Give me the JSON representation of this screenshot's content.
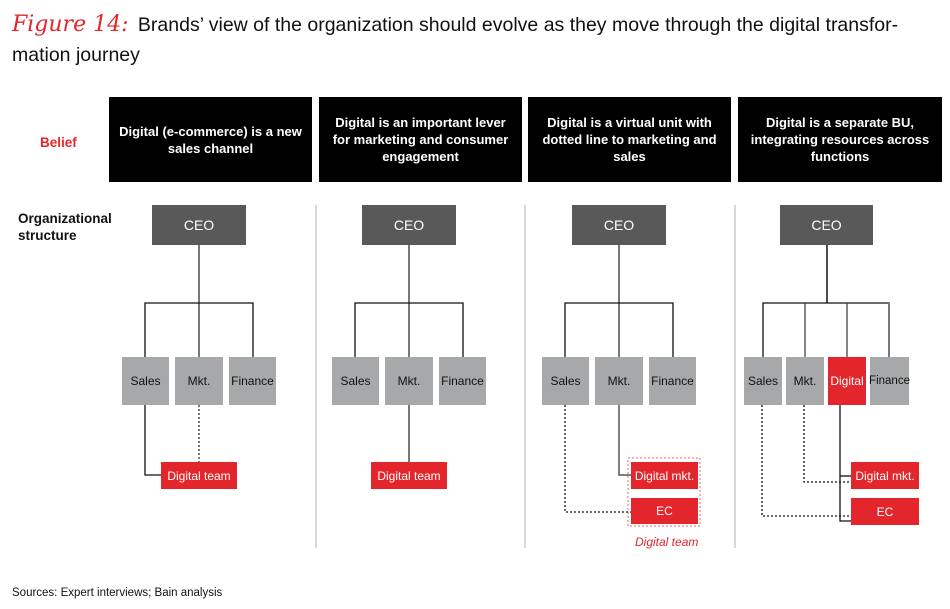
{
  "title": {
    "figure_label": "Figure 14:",
    "text": "Brands’ view of the organization should evolve as they move through the digital transfor-mation journey"
  },
  "row_labels": {
    "belief": "Belief",
    "org_structure": "Organizational structure"
  },
  "colors": {
    "accent_red": "#e3262b",
    "ceo_gray": "#595959",
    "dept_gray": "#a7a8aa",
    "belief_bg": "#000000"
  },
  "stages": [
    {
      "belief": "Digital (e-commerce) is a new sales channel",
      "ceo": "CEO",
      "departments": [
        "Sales",
        "Mkt.",
        "Finance"
      ],
      "digital_units": [
        "Digital team"
      ],
      "links": [
        {
          "from": "Sales",
          "to": "Digital team",
          "style": "solid"
        },
        {
          "from": "Mkt.",
          "to": "Digital team",
          "style": "dotted"
        }
      ]
    },
    {
      "belief": "Digital is an important lever for marketing and consumer engagement",
      "ceo": "CEO",
      "departments": [
        "Sales",
        "Mkt.",
        "Finance"
      ],
      "digital_units": [
        "Digital team"
      ],
      "links": [
        {
          "from": "Mkt.",
          "to": "Digital team",
          "style": "solid"
        }
      ]
    },
    {
      "belief": "Digital is a virtual unit with dotted line to marketing and sales",
      "ceo": "CEO",
      "departments": [
        "Sales",
        "Mkt.",
        "Finance"
      ],
      "digital_units": [
        "Digital mkt.",
        "EC"
      ],
      "group_label": "Digital team",
      "links": [
        {
          "from": "Mkt.",
          "to": "Digital mkt.",
          "style": "solid"
        },
        {
          "from": "Sales",
          "to": "EC",
          "style": "dotted"
        }
      ]
    },
    {
      "belief": "Digital is a separate BU, integrating resources across functions",
      "ceo": "CEO",
      "departments": [
        "Sales",
        "Mkt.",
        "Digital",
        "Finance"
      ],
      "digital_units": [
        "Digital mkt.",
        "EC"
      ],
      "links": [
        {
          "from": "Digital",
          "to": "Digital mkt.",
          "style": "solid"
        },
        {
          "from": "Digital",
          "to": "EC",
          "style": "solid"
        },
        {
          "from": "Mkt.",
          "to": "Digital mkt.",
          "style": "dotted"
        },
        {
          "from": "Sales",
          "to": "EC",
          "style": "dotted"
        }
      ]
    }
  ],
  "source": "Sources: Expert interviews; Bain analysis"
}
